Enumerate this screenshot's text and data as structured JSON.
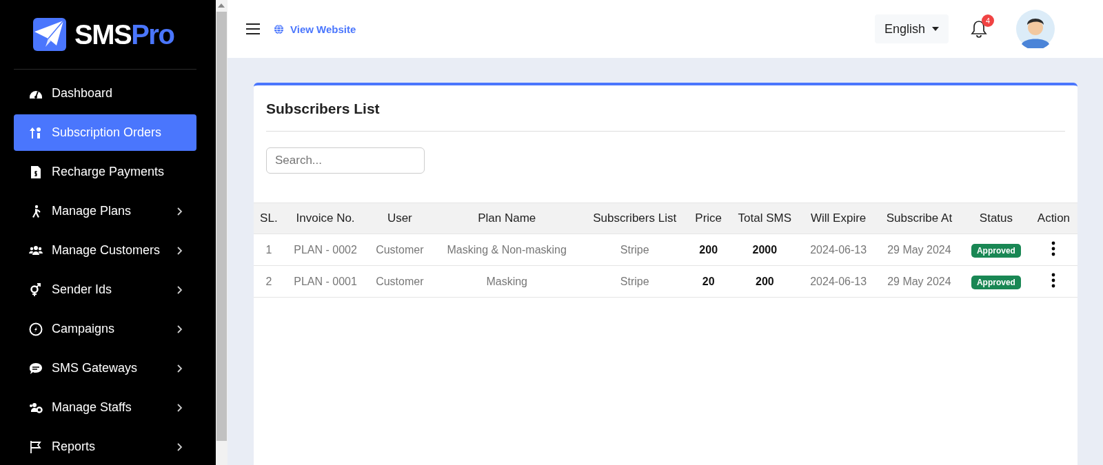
{
  "sidebar": {
    "logo": {
      "brand": "SMS",
      "accent": "Pro"
    },
    "items": [
      {
        "label": "Dashboard",
        "selected": false,
        "has_submenu": false
      },
      {
        "label": "Subscription Orders",
        "selected": true,
        "has_submenu": false
      },
      {
        "label": "Recharge Payments",
        "selected": false,
        "has_submenu": false
      },
      {
        "label": "Manage Plans",
        "selected": false,
        "has_submenu": true
      },
      {
        "label": "Manage Customers",
        "selected": false,
        "has_submenu": true
      },
      {
        "label": "Sender Ids",
        "selected": false,
        "has_submenu": true
      },
      {
        "label": "Campaigns",
        "selected": false,
        "has_submenu": true
      },
      {
        "label": "SMS Gateways",
        "selected": false,
        "has_submenu": true
      },
      {
        "label": "Manage Staffs",
        "selected": false,
        "has_submenu": true
      },
      {
        "label": "Reports",
        "selected": false,
        "has_submenu": true
      }
    ]
  },
  "header": {
    "view_website": "View Website",
    "language": "English",
    "notification_count": "4"
  },
  "card": {
    "title": "Subscribers List",
    "search": {
      "placeholder": "Search..."
    },
    "table": {
      "columns": [
        "SL.",
        "Invoice No.",
        "User",
        "Plan Name",
        "Subscribers List",
        "Price",
        "Total SMS",
        "Will Expire",
        "Subscribe At",
        "Status",
        "Action"
      ],
      "rows": [
        {
          "sl": "1",
          "invoice": "PLAN - 0002",
          "user": "Customer",
          "plan": "Masking & Non-masking",
          "subscribers_list": "Stripe",
          "price": "200",
          "total_sms": "2000",
          "will_expire": "2024-06-13",
          "subscribe_at": "29 May 2024",
          "status": {
            "label": "Approved",
            "color": "#198754"
          }
        },
        {
          "sl": "2",
          "invoice": "PLAN - 0001",
          "user": "Customer",
          "plan": "Masking",
          "subscribers_list": "Stripe",
          "price": "20",
          "total_sms": "200",
          "will_expire": "2024-06-13",
          "subscribe_at": "29 May 2024",
          "status": {
            "label": "Approved",
            "color": "#198754"
          }
        }
      ]
    }
  }
}
